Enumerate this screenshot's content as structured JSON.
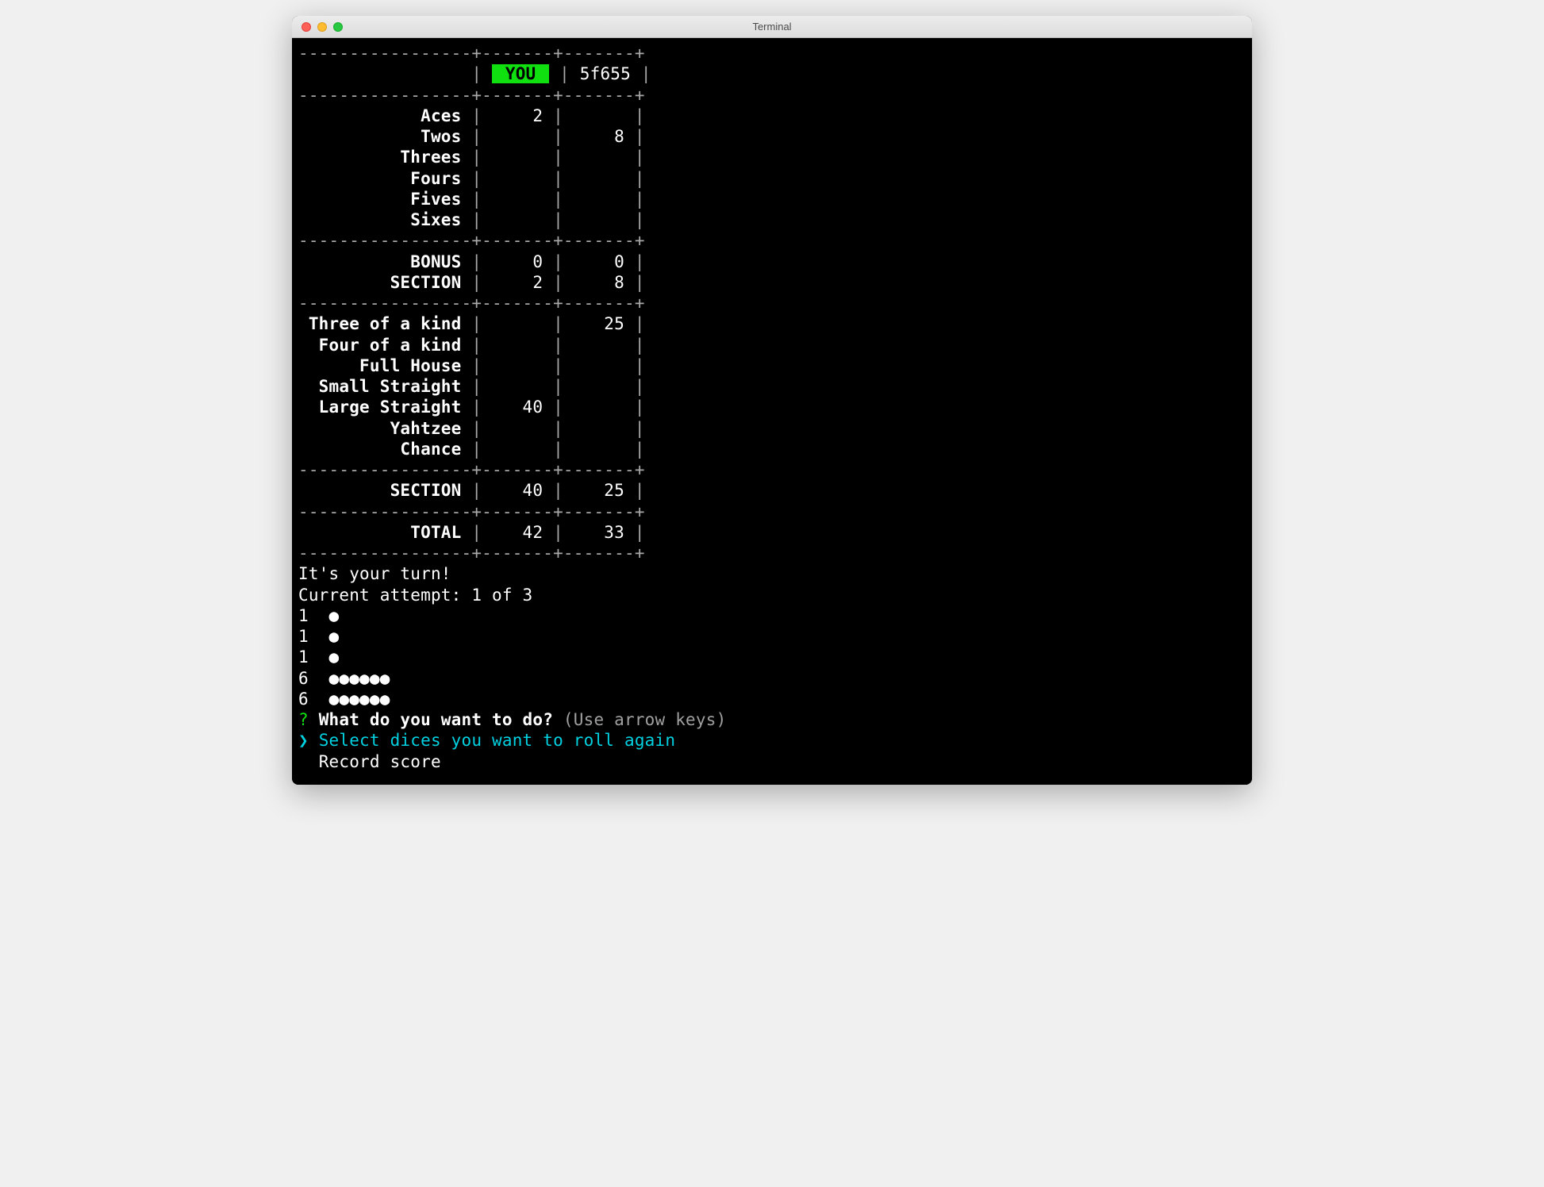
{
  "window": {
    "title": "Terminal"
  },
  "players": {
    "you_label": "YOU",
    "p2_label": "5f655"
  },
  "upper": [
    {
      "name": "Aces",
      "you": "2",
      "p2": ""
    },
    {
      "name": "Twos",
      "you": "",
      "p2": "8"
    },
    {
      "name": "Threes",
      "you": "",
      "p2": ""
    },
    {
      "name": "Fours",
      "you": "",
      "p2": ""
    },
    {
      "name": "Fives",
      "you": "",
      "p2": ""
    },
    {
      "name": "Sixes",
      "you": "",
      "p2": ""
    }
  ],
  "upper_totals": {
    "bonus": {
      "label": "BONUS",
      "you": "0",
      "p2": "0"
    },
    "section": {
      "label": "SECTION",
      "you": "2",
      "p2": "8"
    }
  },
  "lower": [
    {
      "name": "Three of a kind",
      "you": "",
      "p2": "25"
    },
    {
      "name": "Four of a kind",
      "you": "",
      "p2": ""
    },
    {
      "name": "Full House",
      "you": "",
      "p2": ""
    },
    {
      "name": "Small Straight",
      "you": "",
      "p2": ""
    },
    {
      "name": "Large Straight",
      "you": "40",
      "p2": ""
    },
    {
      "name": "Yahtzee",
      "you": "",
      "p2": ""
    },
    {
      "name": "Chance",
      "you": "",
      "p2": ""
    }
  ],
  "lower_totals": {
    "section": {
      "label": "SECTION",
      "you": "40",
      "p2": "25"
    },
    "total": {
      "label": "TOTAL",
      "you": "42",
      "p2": "33"
    }
  },
  "turn_msg": "It's your turn!",
  "attempt_msg": "Current attempt: 1 of 3",
  "dice": [
    {
      "value": "1",
      "pips": "●"
    },
    {
      "value": "1",
      "pips": "●"
    },
    {
      "value": "1",
      "pips": "●"
    },
    {
      "value": "6",
      "pips": "●●●●●●"
    },
    {
      "value": "6",
      "pips": "●●●●●●"
    }
  ],
  "prompt": {
    "q_mark": "?",
    "question": "What do you want to do?",
    "hint": "(Use arrow keys)"
  },
  "menu": {
    "pointer": "❯",
    "selected": "Select dices you want to roll again",
    "other": "Record score"
  },
  "layout": {
    "hr": "-----------------+-------+-------+",
    "col1_width": 16,
    "col2_width": 5,
    "col3_width": 5
  }
}
